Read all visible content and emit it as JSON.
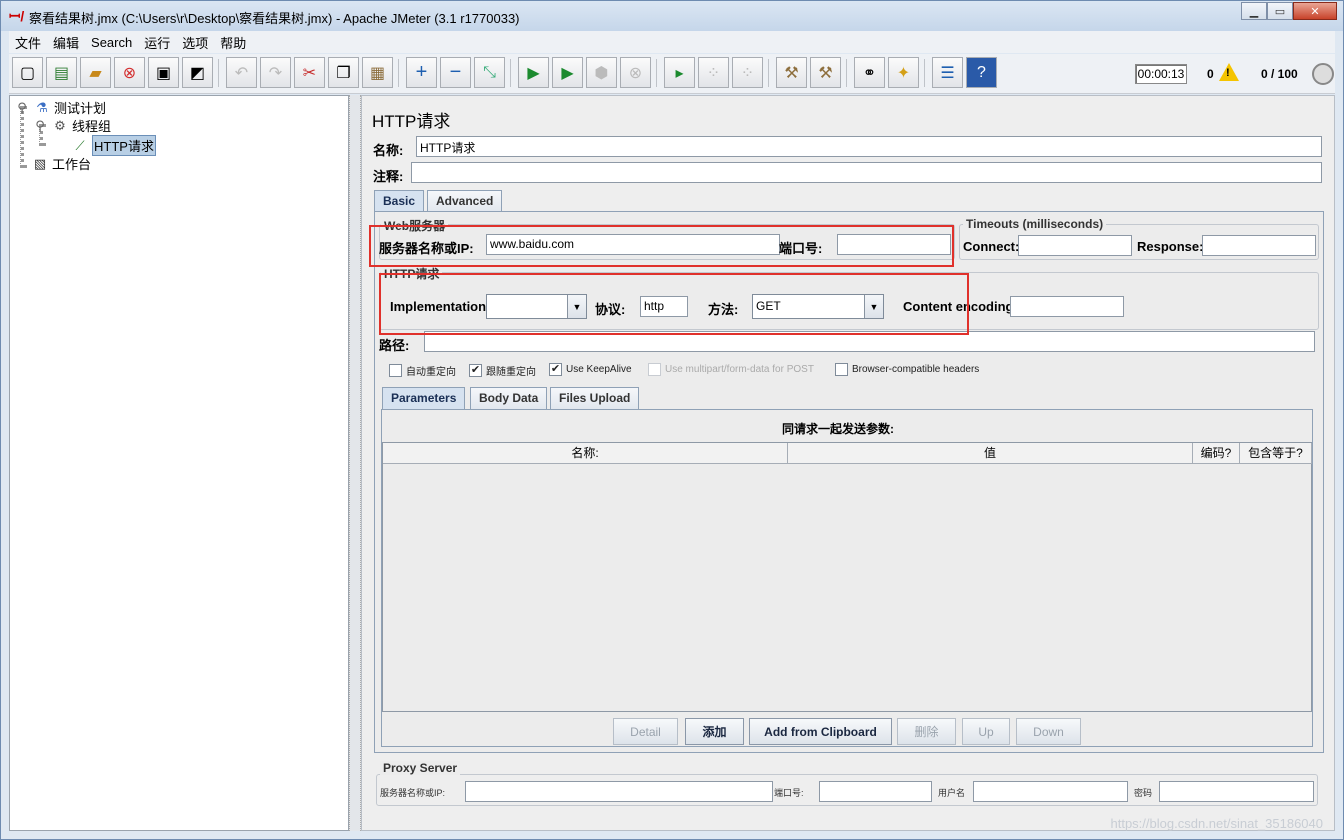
{
  "window": {
    "title": "察看结果树.jmx (C:\\Users\\r\\Desktop\\察看结果树.jmx) - Apache JMeter (3.1 r1770033)"
  },
  "menu": [
    "文件",
    "编辑",
    "Search",
    "运行",
    "选项",
    "帮助"
  ],
  "toolbar": {
    "timer": "00:00:13",
    "warnings": "0",
    "threads": "0 / 100"
  },
  "tree": {
    "plan": "测试计划",
    "thread_group": "线程组",
    "sampler": "HTTP请求",
    "workbench": "工作台"
  },
  "sampler": {
    "heading": "HTTP请求",
    "name_label": "名称:",
    "name_value": "HTTP请求",
    "comment_label": "注释:",
    "tabs": [
      "Basic",
      "Advanced"
    ],
    "web_server": {
      "group_title": "Web服务器",
      "server_label": "服务器名称或IP:",
      "server_value": "www.baidu.com",
      "port_label": "端口号:",
      "port_value": ""
    },
    "timeouts": {
      "group_title": "Timeouts (milliseconds)",
      "connect_label": "Connect:",
      "response_label": "Response:"
    },
    "http_request": {
      "group_title": "HTTP请求",
      "impl_label": "Implementation:",
      "impl_value": "",
      "protocol_label": "协议:",
      "protocol_value": "http",
      "method_label": "方法:",
      "method_value": "GET",
      "encoding_label": "Content encoding:",
      "path_label": "路径:"
    },
    "checkboxes": [
      {
        "label": "自动重定向",
        "checked": false
      },
      {
        "label": "跟随重定向",
        "checked": true
      },
      {
        "label": "Use KeepAlive",
        "checked": true
      },
      {
        "label": "Use multipart/form-data for POST",
        "checked": false
      },
      {
        "label": "Browser-compatible headers",
        "checked": false
      }
    ],
    "sub_tabs": [
      "Parameters",
      "Body Data",
      "Files Upload"
    ],
    "params": {
      "caption": "同请求一起发送参数:",
      "columns": [
        "名称:",
        "值",
        "编码?",
        "包含等于?"
      ]
    },
    "buttons": {
      "detail": "Detail",
      "add": "添加",
      "clipboard": "Add from Clipboard",
      "delete": "删除",
      "up": "Up",
      "down": "Down"
    },
    "proxy": {
      "group_title": "Proxy Server",
      "server_label": "服务器名称或IP:",
      "port_label": "端口号:",
      "user_label": "用户名",
      "password_label": "密码"
    }
  },
  "watermark": "https://blog.csdn.net/sinat_35186040"
}
